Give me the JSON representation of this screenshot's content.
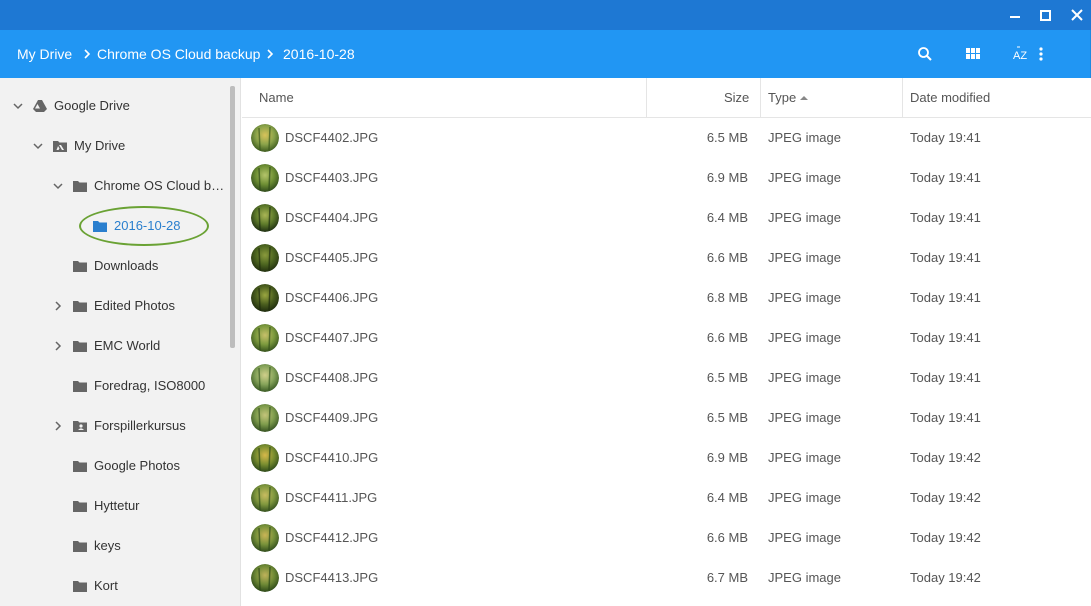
{
  "window": {
    "minimize_icon": "minimize-icon",
    "maximize_icon": "maximize-icon",
    "close_icon": "close-icon"
  },
  "breadcrumb": [
    "My Drive",
    "Chrome OS Cloud backup",
    "2016-10-28"
  ],
  "toolbar": {
    "icons": [
      "search-icon",
      "grid-view-icon",
      "sort-az-icon",
      "more-vert-icon"
    ],
    "sort_label": "AZ"
  },
  "sidebar": {
    "items": [
      {
        "label": "Google Drive",
        "icon": "google-drive-icon",
        "expanded": true
      },
      {
        "label": "My Drive",
        "icon": "my-drive-icon",
        "expanded": true
      },
      {
        "label": "Chrome OS Cloud backup",
        "icon": "folder-icon",
        "expanded": true
      },
      {
        "label": "2016-10-28",
        "icon": "folder-icon",
        "selected": true
      },
      {
        "label": "Downloads",
        "icon": "folder-icon"
      },
      {
        "label": "Edited Photos",
        "icon": "folder-icon",
        "collapsed": true
      },
      {
        "label": "EMC World",
        "icon": "folder-icon",
        "collapsed": true
      },
      {
        "label": "Foredrag, ISO8000",
        "icon": "folder-icon"
      },
      {
        "label": "Forspillerkursus",
        "icon": "shared-folder-icon",
        "collapsed": true
      },
      {
        "label": "Google Photos",
        "icon": "folder-icon"
      },
      {
        "label": "Hyttetur",
        "icon": "folder-icon"
      },
      {
        "label": "keys",
        "icon": "folder-icon"
      },
      {
        "label": "Kort",
        "icon": "folder-icon"
      }
    ]
  },
  "columns": {
    "name": "Name",
    "size": "Size",
    "type": "Type",
    "date": "Date modified",
    "sort_indicator": "sort-ascending-icon"
  },
  "files": [
    {
      "name": "DSCF4402.JPG",
      "size": "6.5 MB",
      "type": "JPEG image",
      "date": "Today 19:41"
    },
    {
      "name": "DSCF4403.JPG",
      "size": "6.9 MB",
      "type": "JPEG image",
      "date": "Today 19:41"
    },
    {
      "name": "DSCF4404.JPG",
      "size": "6.4 MB",
      "type": "JPEG image",
      "date": "Today 19:41"
    },
    {
      "name": "DSCF4405.JPG",
      "size": "6.6 MB",
      "type": "JPEG image",
      "date": "Today 19:41"
    },
    {
      "name": "DSCF4406.JPG",
      "size": "6.8 MB",
      "type": "JPEG image",
      "date": "Today 19:41"
    },
    {
      "name": "DSCF4407.JPG",
      "size": "6.6 MB",
      "type": "JPEG image",
      "date": "Today 19:41"
    },
    {
      "name": "DSCF4408.JPG",
      "size": "6.5 MB",
      "type": "JPEG image",
      "date": "Today 19:41"
    },
    {
      "name": "DSCF4409.JPG",
      "size": "6.5 MB",
      "type": "JPEG image",
      "date": "Today 19:41"
    },
    {
      "name": "DSCF4410.JPG",
      "size": "6.9 MB",
      "type": "JPEG image",
      "date": "Today 19:42"
    },
    {
      "name": "DSCF4411.JPG",
      "size": "6.4 MB",
      "type": "JPEG image",
      "date": "Today 19:42"
    },
    {
      "name": "DSCF4412.JPG",
      "size": "6.6 MB",
      "type": "JPEG image",
      "date": "Today 19:42"
    },
    {
      "name": "DSCF4413.JPG",
      "size": "6.7 MB",
      "type": "JPEG image",
      "date": "Today 19:42"
    }
  ],
  "colors": {
    "caption": "#1e78d3",
    "header": "#2196f3",
    "sidebar_bg": "#f2f2f2",
    "selected_text": "#2a7fce",
    "annotation_ring": "#6aa234"
  }
}
